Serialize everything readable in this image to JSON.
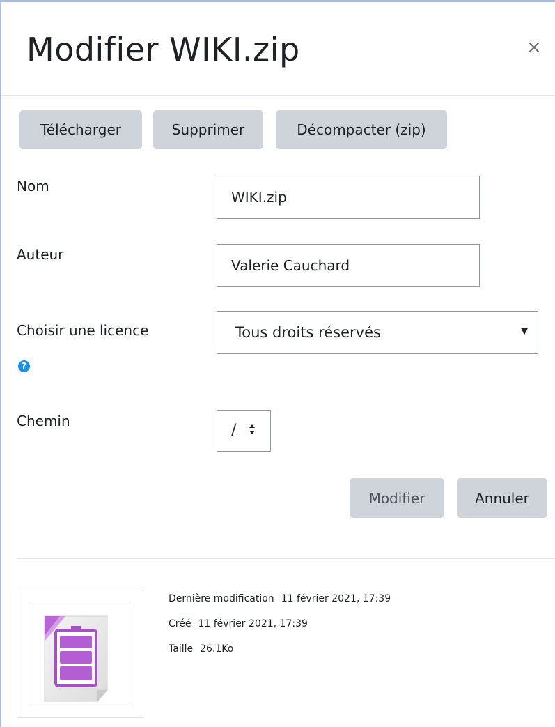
{
  "dialog": {
    "title": "Modifier WIKI.zip",
    "close_glyph": "×"
  },
  "toolbar": {
    "download_label": "Télécharger",
    "delete_label": "Supprimer",
    "unzip_label": "Décompacter (zip)"
  },
  "form": {
    "name_label": "Nom",
    "name_value": "WIKI.zip",
    "author_label": "Auteur",
    "author_value": "Valerie Cauchard",
    "license_label": "Choisir une licence",
    "license_value": "Tous droits réservés",
    "path_label": "Chemin",
    "path_value": "/"
  },
  "actions": {
    "modify_label": "Modifier",
    "cancel_label": "Annuler"
  },
  "file_info": {
    "modified_label": "Dernière modification",
    "modified_value": "11 février 2021, 17:39",
    "created_label": "Créé",
    "created_value": "11 février 2021, 17:39",
    "size_label": "Taille",
    "size_value": "26.1Ko"
  },
  "icons": {
    "help": "help-icon",
    "file": "zip-file-icon",
    "close": "close-icon",
    "dropdown": "caret-down-icon",
    "sort": "sort-arrows-icon"
  },
  "colors": {
    "button_bg": "#ced4da",
    "help_blue": "#1e90e8",
    "zip_purple": "#a64fc7"
  }
}
